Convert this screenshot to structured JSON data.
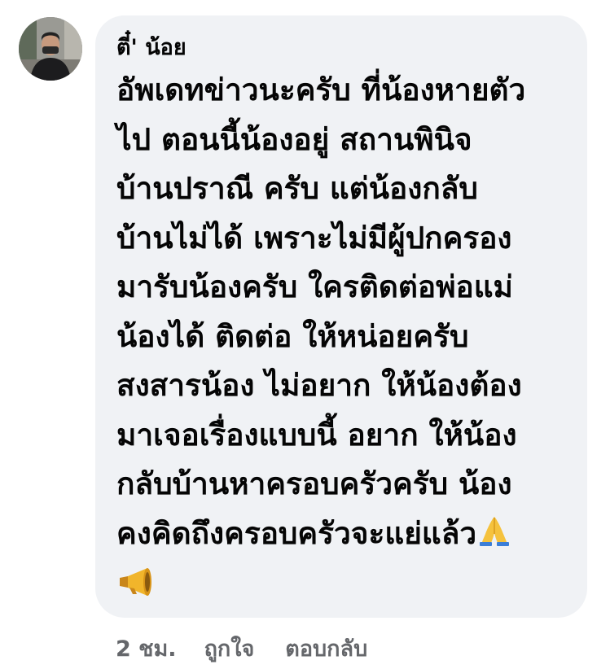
{
  "comment": {
    "author": "ตี๋' น้อย",
    "avatar_icon": "user-avatar-photo",
    "lines": [
      "อัพเดทข่าวนะครับ ที่น้องหายตัว",
      "ไป ตอนนี้น้องอยู่ สถานพินิจ",
      "บ้านปราณี ครับ แต่น้องกลับ",
      "บ้านไม่ได้ เพราะไม่มีผู้ปกครอง",
      "มารับน้องครับ ใครติดต่อพ่อแม่",
      "น้องได้ ติดต่อ ให้หน่อยครับ",
      "สงสารน้อง ไม่อยาก ให้น้องต้อง",
      "มาเจอเรื่องแบบนี้ อยาก ให้น้อง",
      "กลับบ้านหาครอบครัวครับ น้อง",
      "คงคิดถึงครอบครัวจะแย่แล้ว"
    ],
    "emoji_after_text": "folded-hands-emoji",
    "trailing_emoji": "megaphone-emoji"
  },
  "actions": {
    "time": "2 ชม.",
    "like_label": "ถูกใจ",
    "reply_label": "ตอบกลับ"
  },
  "colors": {
    "bubble_bg": "#f0f2f5",
    "text": "#050505",
    "meta_text": "#65676b"
  }
}
